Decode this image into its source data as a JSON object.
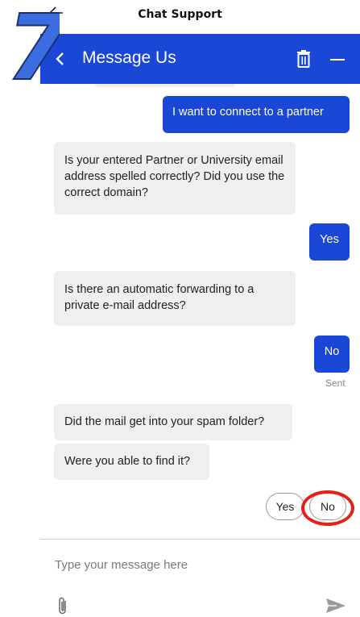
{
  "topbar": {
    "title": "Chat Support"
  },
  "badge": {
    "step": "7"
  },
  "header": {
    "title": "Message Us"
  },
  "messages": [
    {
      "from": "user",
      "text": "I want to connect to a partner"
    },
    {
      "from": "bot",
      "text": "Is your entered Partner or University email address spelled correctly? Did you use the correct domain?"
    },
    {
      "from": "user",
      "text": "Yes"
    },
    {
      "from": "bot",
      "text": "Is there an automatic forwarding to a private e-mail address?"
    },
    {
      "from": "user",
      "text": "No"
    },
    {
      "from": "bot",
      "text": "Did the mail get into your spam folder?"
    },
    {
      "from": "bot",
      "text": "Were you able to find it?"
    }
  ],
  "status": {
    "sent": "Sent"
  },
  "quick_replies": [
    "Yes",
    "No"
  ],
  "composer": {
    "placeholder": "Type your message here"
  },
  "colors": {
    "brand": "#1a47d6",
    "highlight": "#e3201a",
    "badge": "#3a6de0"
  }
}
